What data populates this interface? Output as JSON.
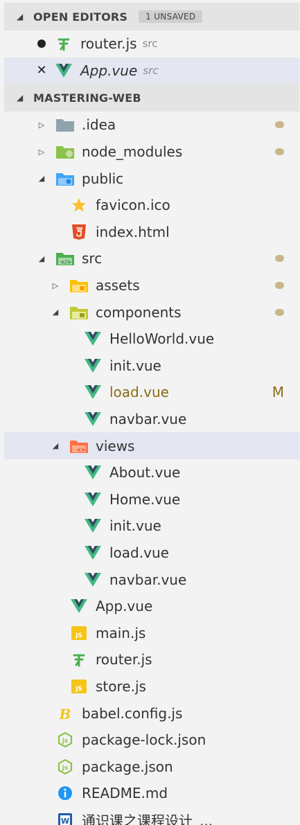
{
  "open_editors": {
    "header": "OPEN EDITORS",
    "badge": "1 UNSAVED",
    "items": [
      {
        "name": "router.js",
        "desc": "src",
        "icon": "router-icon"
      },
      {
        "name": "App.vue",
        "desc": "src",
        "icon": "vue-icon"
      }
    ]
  },
  "workspace": {
    "header": "MASTERING-WEB",
    "tree": [
      {
        "name": ".idea",
        "icon": "folder-gray-icon",
        "depth": 0,
        "twisty": "closed",
        "deco": "dot"
      },
      {
        "name": "node_modules",
        "icon": "folder-node-icon",
        "depth": 0,
        "twisty": "closed",
        "deco": "dot"
      },
      {
        "name": "public",
        "icon": "folder-public-icon",
        "depth": 0,
        "twisty": "open",
        "deco": ""
      },
      {
        "name": "favicon.ico",
        "icon": "favicon-icon",
        "depth": 1,
        "twisty": "none",
        "deco": ""
      },
      {
        "name": "index.html",
        "icon": "html5-icon",
        "depth": 1,
        "twisty": "none",
        "deco": ""
      },
      {
        "name": "src",
        "icon": "folder-src-icon",
        "depth": 0,
        "twisty": "open",
        "deco": "dot"
      },
      {
        "name": "assets",
        "icon": "folder-assets-icon",
        "depth": 1,
        "twisty": "closed",
        "deco": "dot"
      },
      {
        "name": "components",
        "icon": "folder-components-icon",
        "depth": 1,
        "twisty": "open",
        "deco": "dot"
      },
      {
        "name": "HelloWorld.vue",
        "icon": "vue-icon",
        "depth": 2,
        "twisty": "none",
        "deco": ""
      },
      {
        "name": "init.vue",
        "icon": "vue-icon",
        "depth": 2,
        "twisty": "none",
        "deco": ""
      },
      {
        "name": "load.vue",
        "icon": "vue-icon",
        "depth": 2,
        "twisty": "none",
        "deco": "M",
        "modified": true
      },
      {
        "name": "navbar.vue",
        "icon": "vue-icon",
        "depth": 2,
        "twisty": "none",
        "deco": ""
      },
      {
        "name": "views",
        "icon": "folder-views-icon",
        "depth": 1,
        "twisty": "open",
        "deco": "",
        "selected": true
      },
      {
        "name": "About.vue",
        "icon": "vue-icon",
        "depth": 2,
        "twisty": "none",
        "deco": ""
      },
      {
        "name": "Home.vue",
        "icon": "vue-icon",
        "depth": 2,
        "twisty": "none",
        "deco": ""
      },
      {
        "name": "init.vue",
        "icon": "vue-icon",
        "depth": 2,
        "twisty": "none",
        "deco": ""
      },
      {
        "name": "load.vue",
        "icon": "vue-icon",
        "depth": 2,
        "twisty": "none",
        "deco": ""
      },
      {
        "name": "navbar.vue",
        "icon": "vue-icon",
        "depth": 2,
        "twisty": "none",
        "deco": ""
      },
      {
        "name": "App.vue",
        "icon": "vue-icon",
        "depth": 1,
        "twisty": "none",
        "deco": ""
      },
      {
        "name": "main.js",
        "icon": "js-icon",
        "depth": 1,
        "twisty": "none",
        "deco": ""
      },
      {
        "name": "router.js",
        "icon": "router-icon",
        "depth": 1,
        "twisty": "none",
        "deco": ""
      },
      {
        "name": "store.js",
        "icon": "js-icon",
        "depth": 1,
        "twisty": "none",
        "deco": ""
      },
      {
        "name": "babel.config.js",
        "icon": "babel-icon",
        "depth": 0,
        "twisty": "none",
        "deco": ""
      },
      {
        "name": "package-lock.json",
        "icon": "nodejs-icon",
        "depth": 0,
        "twisty": "none",
        "deco": ""
      },
      {
        "name": "package.json",
        "icon": "nodejs-icon",
        "depth": 0,
        "twisty": "none",
        "deco": ""
      },
      {
        "name": "README.md",
        "icon": "info-icon",
        "depth": 0,
        "twisty": "none",
        "deco": ""
      },
      {
        "name": "通识课之课程设计_...",
        "icon": "word-icon",
        "depth": 0,
        "twisty": "none",
        "deco": ""
      }
    ]
  },
  "colors": {
    "vue_green": "#41b883",
    "vue_dark": "#35495e",
    "modified": "#8a6b13",
    "selected_bg": "#e4e6f1",
    "header_bg": "#e4e4e4"
  }
}
